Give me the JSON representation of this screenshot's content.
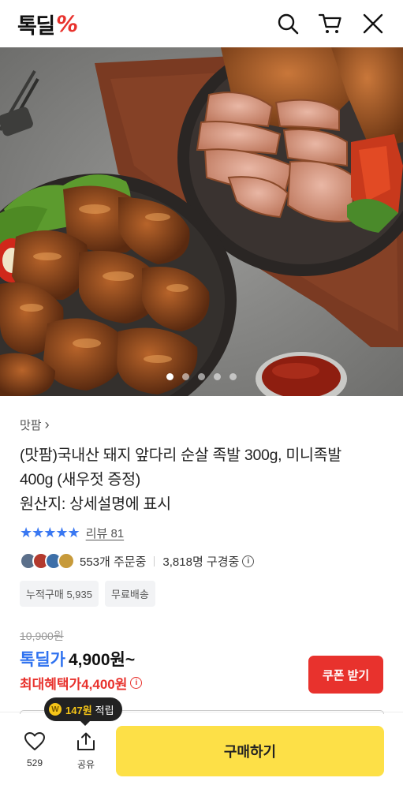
{
  "header": {
    "logo_text": "톡딜",
    "logo_mark": "%",
    "icons": [
      "search-icon",
      "cart-icon",
      "close-icon"
    ]
  },
  "hero": {
    "slide_count": 5,
    "active_slide": 1
  },
  "product": {
    "brand": "맛팜",
    "brand_chevron": "›",
    "title_line1": "(맛팜)국내산 돼지 앞다리 순살 족발 300g, 미니족발",
    "title_line2": "400g (새우젓 증정)",
    "origin": "원산지: 상세설명에 표시",
    "stars": "★★★★★",
    "rating_fraction": 0.95,
    "review_label": "리뷰 81",
    "orders": "553개 주문중",
    "watchers": "3,818명 구경중",
    "chips": [
      "누적구매 5,935",
      "무료배송"
    ],
    "original_price": "10,900원",
    "deal_label": "톡딜가",
    "deal_price": "4,900원~",
    "max_label": "최대혜택가",
    "max_price": "4,400원",
    "coupon_button": "쿠폰 받기"
  },
  "bottom": {
    "reward_amount": "147원",
    "reward_label": "적립",
    "coin_glyph": "W",
    "like_count": "529",
    "share_label": "공유",
    "buy_button": "구매하기"
  },
  "colors": {
    "accent_red": "#e8322d",
    "accent_blue": "#2f72f0",
    "buy_yellow": "#fde047"
  }
}
